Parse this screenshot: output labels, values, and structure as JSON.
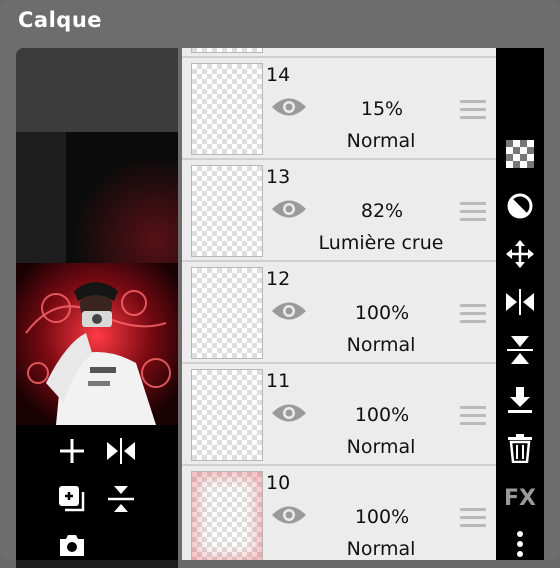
{
  "window": {
    "title": "Calque"
  },
  "layers": [
    {
      "number": "14",
      "opacity": "15%",
      "blend_mode": "Normal"
    },
    {
      "number": "13",
      "opacity": "82%",
      "blend_mode": "Lumière crue"
    },
    {
      "number": "12",
      "opacity": "100%",
      "blend_mode": "Normal"
    },
    {
      "number": "11",
      "opacity": "100%",
      "blend_mode": "Normal"
    },
    {
      "number": "10",
      "opacity": "100%",
      "blend_mode": "Normal"
    }
  ],
  "left_tools": [
    "add-icon",
    "flip-horizontal-icon",
    "duplicate-icon",
    "merge-icon",
    "camera-icon"
  ],
  "right_actions": [
    "transparency-lock-icon",
    "clipping-icon",
    "move-icon",
    "flip-horizontal-icon",
    "flip-vertical-icon",
    "merge-down-icon",
    "trash-icon",
    "fx-icon",
    "more-icon"
  ],
  "fx_label": "FX",
  "colors": {
    "panel": "#6d6d6d",
    "list_row": "#ececec",
    "action_bar": "#000000",
    "accent_red": "#c0141e"
  }
}
